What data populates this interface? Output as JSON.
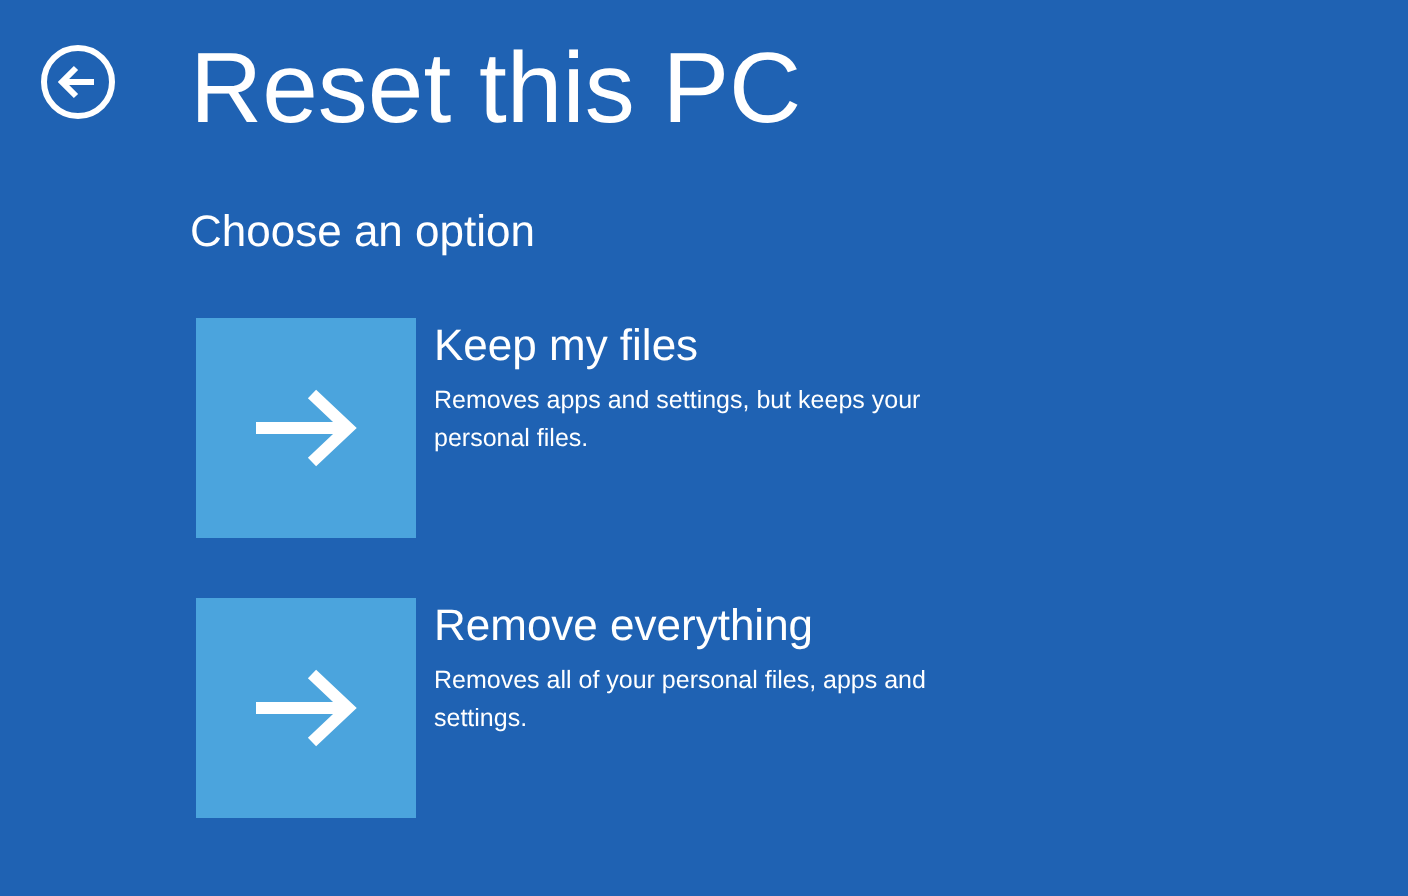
{
  "title": "Reset this PC",
  "subtitle": "Choose an option",
  "options": [
    {
      "title": "Keep my files",
      "description": "Removes apps and settings, but keeps your personal files."
    },
    {
      "title": "Remove everything",
      "description": "Removes all of your personal files, apps and settings."
    }
  ]
}
